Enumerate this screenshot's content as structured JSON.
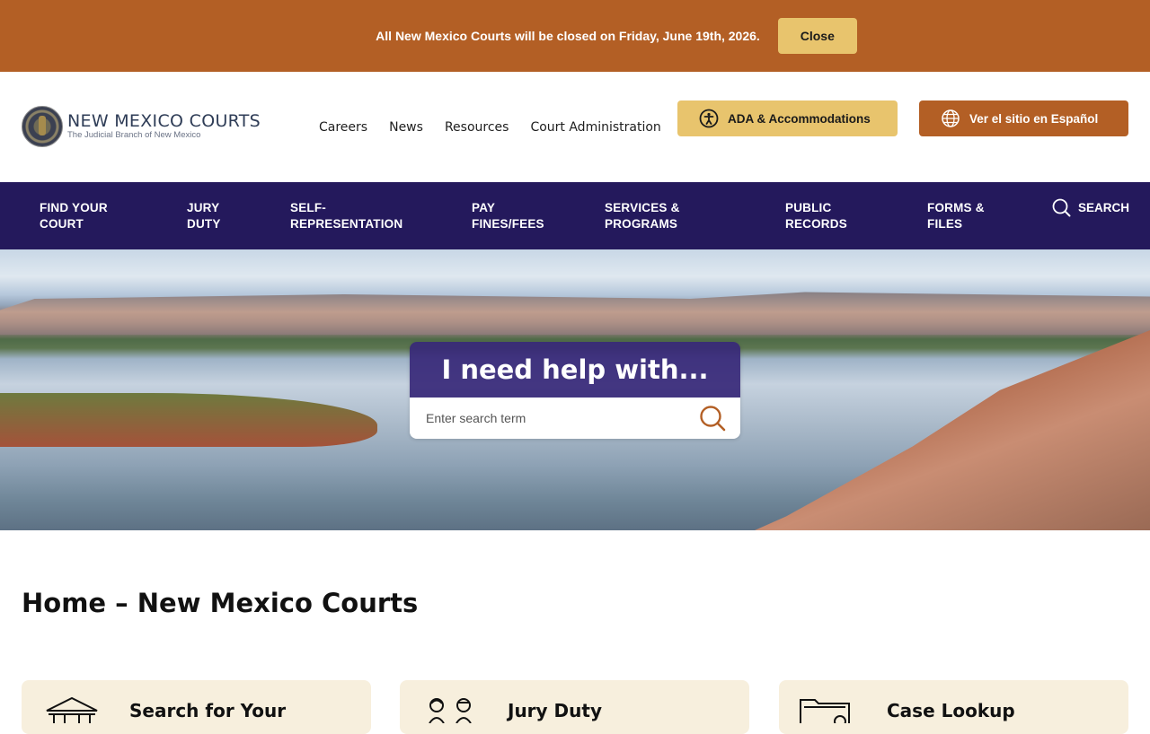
{
  "alert": {
    "message": "All New Mexico Courts will be closed on Friday, June 19th, 2026.",
    "close_label": "Close"
  },
  "header": {
    "logo_title": "NEW MEXICO COURTS",
    "logo_subtitle": "The Judicial Branch of New Mexico",
    "top_links": [
      "Careers",
      "News",
      "Resources",
      "Court Administration"
    ],
    "ada_label": "ADA & Accommodations",
    "spanish_label": "Ver el sitio en Español"
  },
  "main_nav": {
    "items": [
      {
        "line1": "FIND YOUR",
        "line2": "COURT"
      },
      {
        "line1": "JURY",
        "line2": "DUTY"
      },
      {
        "line1": "SELF-",
        "line2": "REPRESENTATION"
      },
      {
        "line1": "PAY",
        "line2": "FINES/FEES"
      },
      {
        "line1": "SERVICES &",
        "line2": "PROGRAMS"
      },
      {
        "line1": "PUBLIC",
        "line2": "RECORDS"
      },
      {
        "line1": "FORMS &",
        "line2": "FILES"
      }
    ],
    "search_label": "SEARCH"
  },
  "hero": {
    "title": "I need help with...",
    "search_placeholder": "Enter search term"
  },
  "page_title": "Home – New Mexico Courts",
  "cards": [
    {
      "label": "Search for Your",
      "icon": "courthouse-icon"
    },
    {
      "label": "Jury Duty",
      "icon": "jurors-icon"
    },
    {
      "label": "Case Lookup",
      "icon": "folder-icon"
    }
  ],
  "colors": {
    "banner": "#b35f25",
    "accent_gold": "#e8c46d",
    "nav_purple": "#24195c",
    "card_bg": "#f7efdd"
  }
}
